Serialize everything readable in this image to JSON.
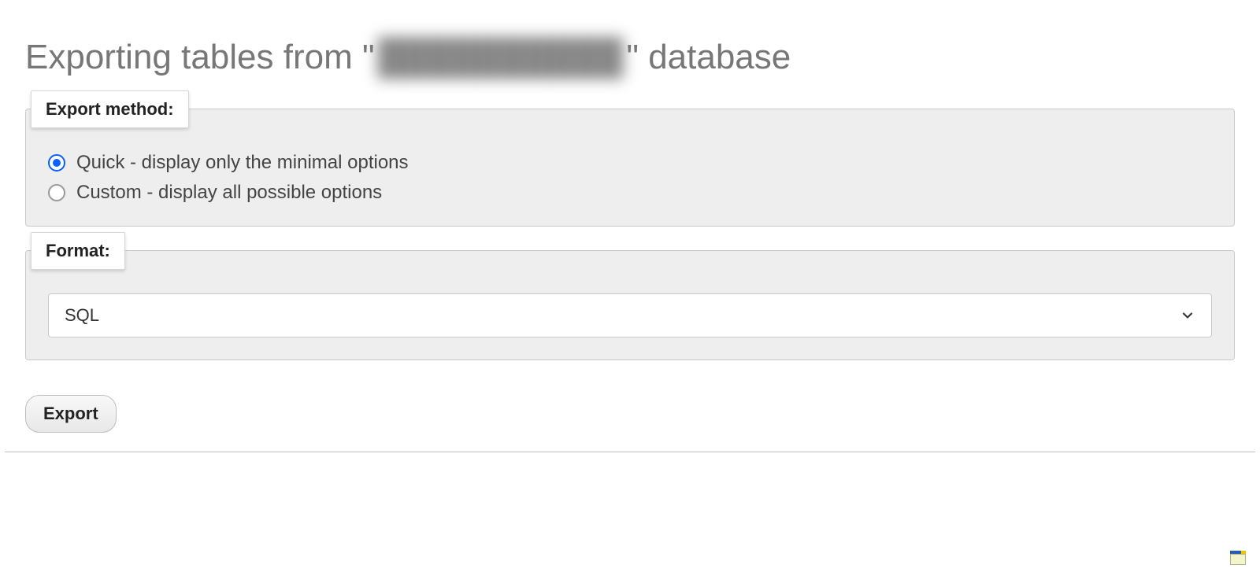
{
  "title": {
    "prefix": "Exporting tables from \"",
    "database_name": "██████████",
    "suffix": "\" database"
  },
  "export_method": {
    "legend": "Export method:",
    "options": [
      {
        "label": "Quick - display only the minimal options",
        "checked": true
      },
      {
        "label": "Custom - display all possible options",
        "checked": false
      }
    ]
  },
  "format": {
    "legend": "Format:",
    "selected": "SQL"
  },
  "buttons": {
    "export": "Export"
  }
}
